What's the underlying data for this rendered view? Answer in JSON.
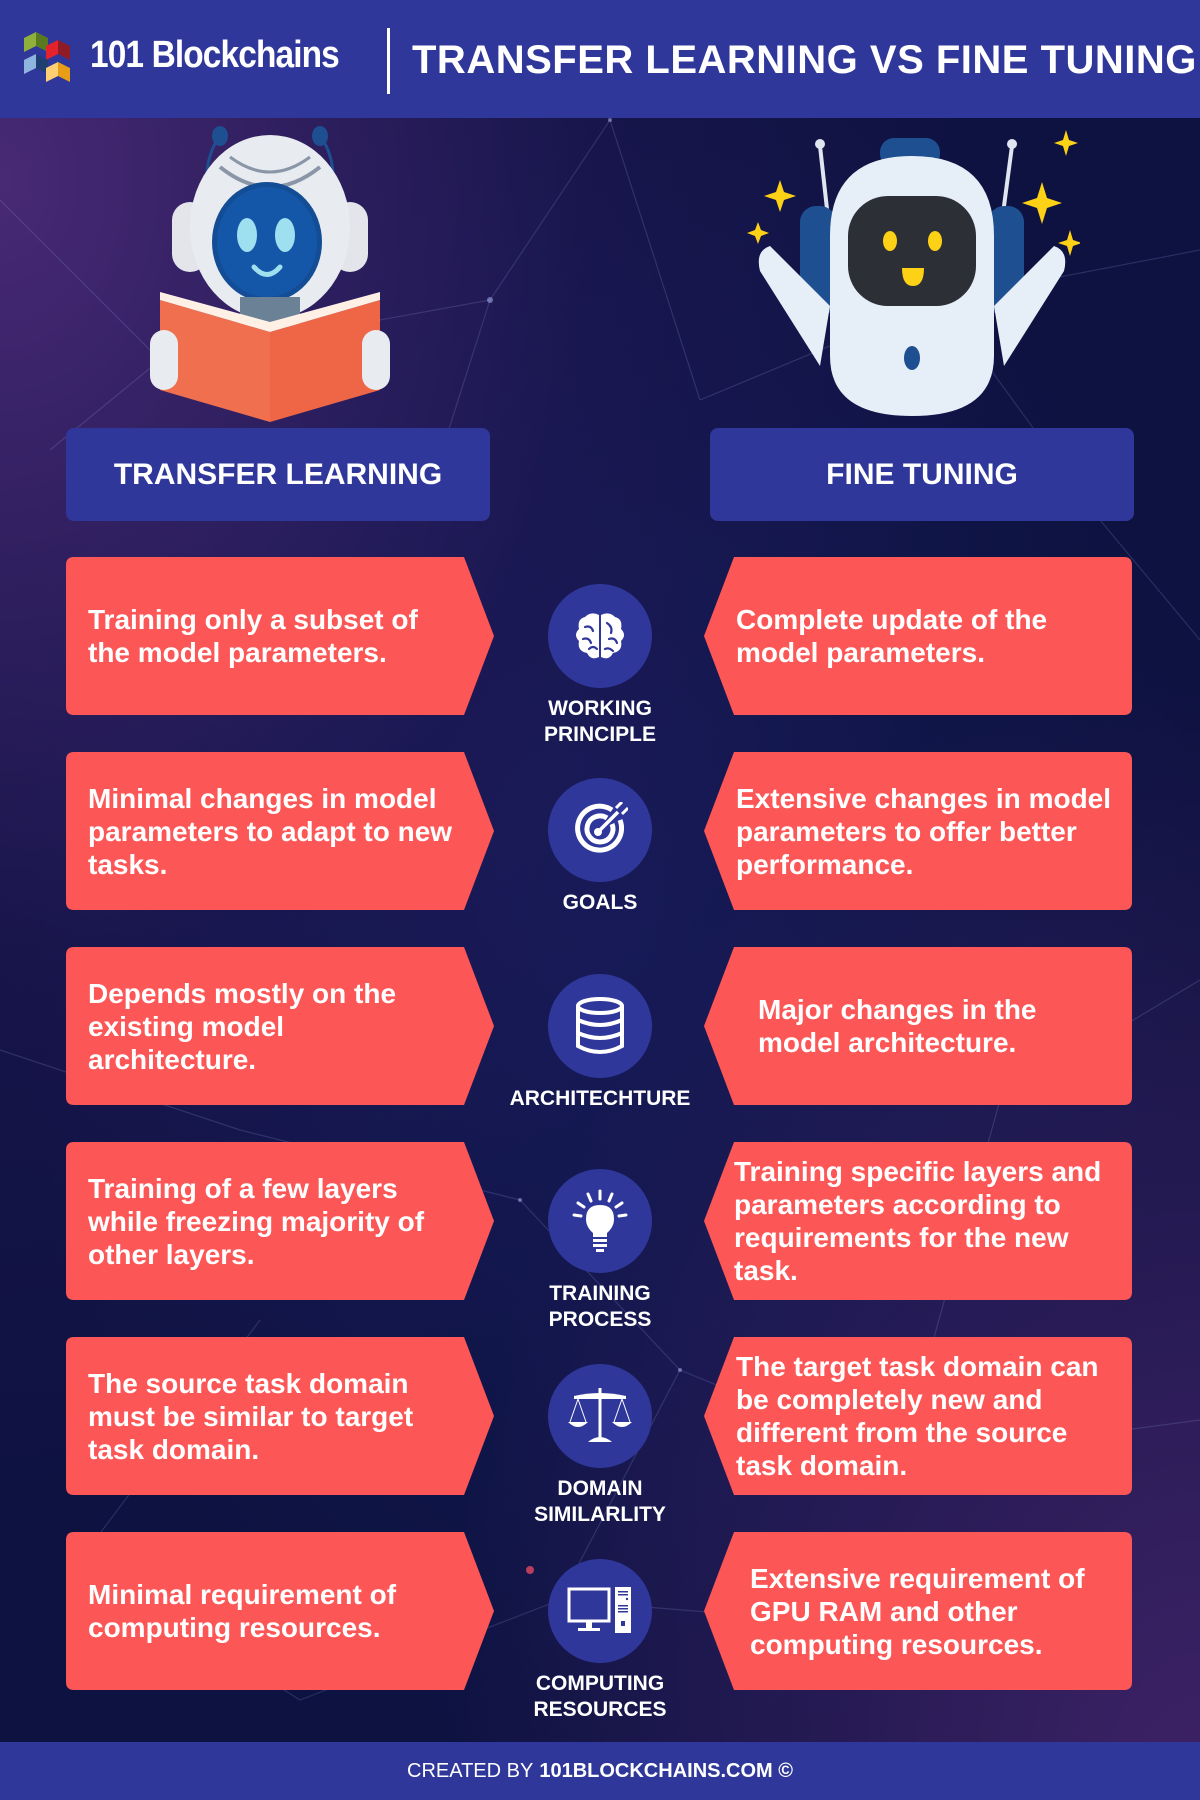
{
  "header": {
    "brand": "101 Blockchains",
    "title": "TRANSFER LEARNING VS FINE TUNING",
    "logo_icon": "stacked-cubes-logo"
  },
  "columns": {
    "left": {
      "title": "TRANSFER LEARNING",
      "illustration": "robot-reading-book"
    },
    "right": {
      "title": "FINE TUNING",
      "illustration": "happy-robot-with-sparkles"
    }
  },
  "rows": [
    {
      "label": "WORKING PRINCIPLE",
      "icon": "brain-icon",
      "left": "Training only a subset of the model parameters.",
      "right": "Complete update of the model parameters."
    },
    {
      "label": "GOALS",
      "icon": "target-icon",
      "left": "Minimal changes in model parameters to adapt to new tasks.",
      "right": "Extensive changes in model parameters to offer better performance."
    },
    {
      "label": "ARCHITECHTURE",
      "icon": "database-icon",
      "left": "Depends mostly on the existing model architecture.",
      "right": "Major changes in the model architecture."
    },
    {
      "label": "TRAINING\nPROCESS",
      "icon": "lightbulb-icon",
      "left": "Training of a few layers while freezing majority of other layers.",
      "right": "Training specific layers and parameters according to requirements for the new task."
    },
    {
      "label": "DOMAIN\nSIMILARLITY",
      "icon": "scales-icon",
      "left": "The source task domain must be similar to target task domain.",
      "right": "The target task domain can be completely new and different from the source task domain."
    },
    {
      "label": "COMPUTING\nRESOURCES",
      "icon": "computer-icon",
      "left": "Minimal requirement of computing resources.",
      "right": "Extensive requirement of GPU RAM and other computing resources."
    }
  ],
  "footer": {
    "prefix": "CREATED BY",
    "site": "101BLOCKCHAINS.COM ©"
  },
  "colors": {
    "header_bg": "#30379a",
    "card_bg": "#fd5656",
    "page_bg": "#0f1440",
    "icon_circle": "#30379a",
    "sparkle": "#fcd116"
  }
}
